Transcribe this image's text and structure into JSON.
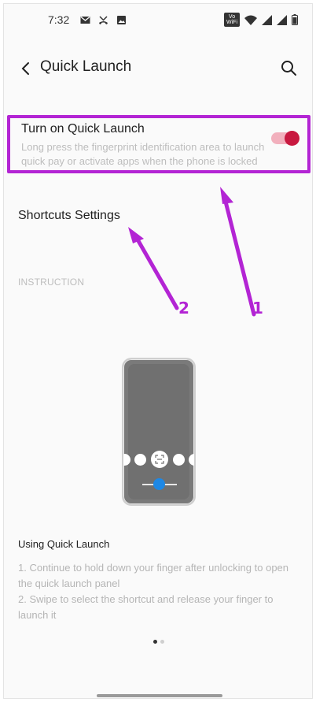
{
  "status_bar": {
    "time": "7:32",
    "left_icons": [
      "gmail-icon",
      "missed-call-icon",
      "image-icon"
    ],
    "right_icons": [
      "volte-wifi-icon",
      "wifi-icon",
      "signal-icon",
      "signal-icon",
      "battery-icon"
    ],
    "volte_label": "VoLTE WiFi"
  },
  "app_bar": {
    "title": "Quick Launch",
    "back_icon": "back-arrow-icon",
    "search_icon": "search-icon"
  },
  "quick_launch": {
    "title": "Turn on Quick Launch",
    "description": "Long press the fingerprint identification area to launch quick pay or activate apps when the phone is locked",
    "toggle_on": true,
    "toggle_color": "#c8183f"
  },
  "shortcuts": {
    "label": "Shortcuts Settings"
  },
  "instruction": {
    "header": "INSTRUCTION"
  },
  "annotations": {
    "arrow_1_label": "1",
    "arrow_2_label": "2",
    "highlight_color": "#b324d4"
  },
  "using": {
    "title": "Using Quick Launch",
    "step_1": "1. Continue to hold down your finger after unlocking to open the quick launch panel",
    "step_2": "2. Swipe to select the shortcut and release your finger to launch it"
  },
  "page_indicator": {
    "current": 1,
    "total": 2
  }
}
